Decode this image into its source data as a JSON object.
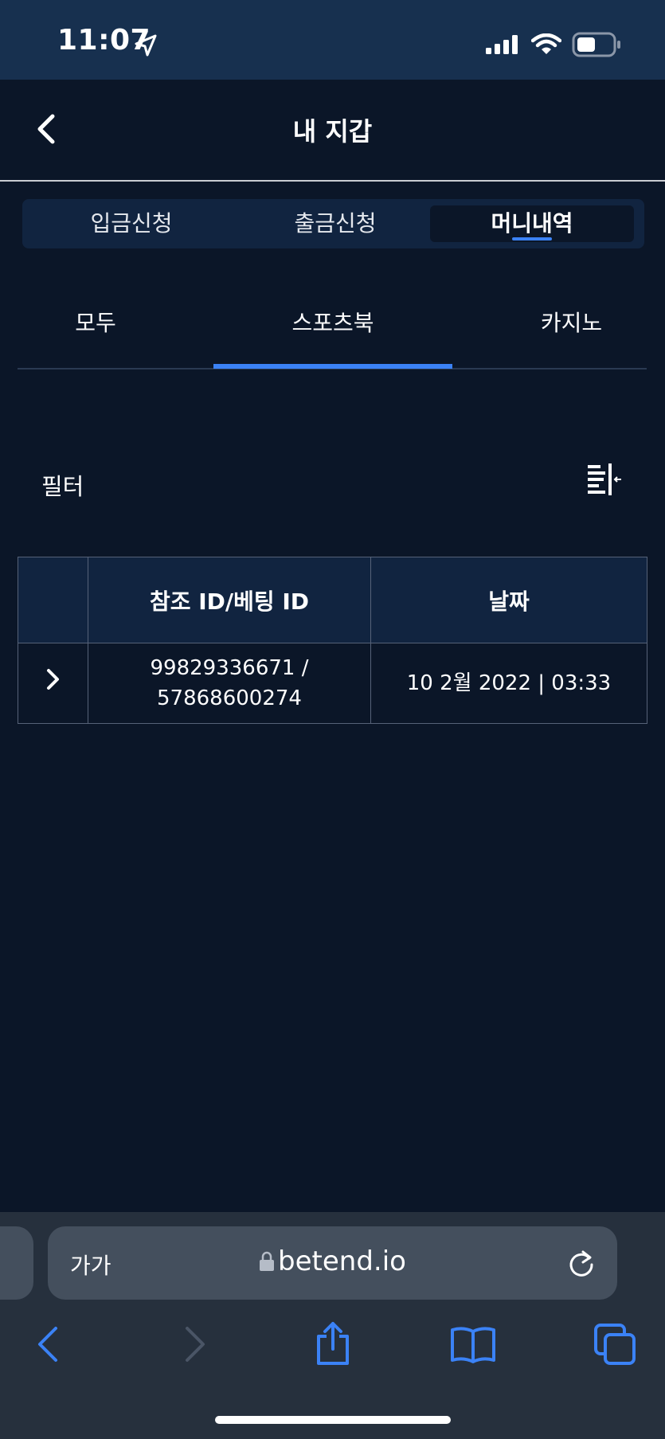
{
  "status_bar": {
    "time": "11:07"
  },
  "header": {
    "title": "내 지갑"
  },
  "tabs": [
    {
      "label": "입금신청",
      "active": false
    },
    {
      "label": "출금신청",
      "active": false
    },
    {
      "label": "머니내역",
      "active": true
    }
  ],
  "sub_tabs": [
    {
      "label": "모두",
      "active": false
    },
    {
      "label": "스포츠북",
      "active": true
    },
    {
      "label": "카지노",
      "active": false
    }
  ],
  "filter": {
    "label": "필터"
  },
  "table": {
    "headers": [
      "",
      "참조 ID/베팅 ID",
      "날짜"
    ],
    "rows": [
      {
        "ref_id_line1": "99829336671 /",
        "ref_id_line2": "57868600274",
        "date": "10 2월 2022 | 03:33"
      }
    ]
  },
  "browser": {
    "aa_label": "가가",
    "url": "betend.io"
  },
  "colors": {
    "accent": "#3b82f6",
    "background": "#0b1628",
    "panel": "#112440",
    "status_bar": "#17304f"
  }
}
